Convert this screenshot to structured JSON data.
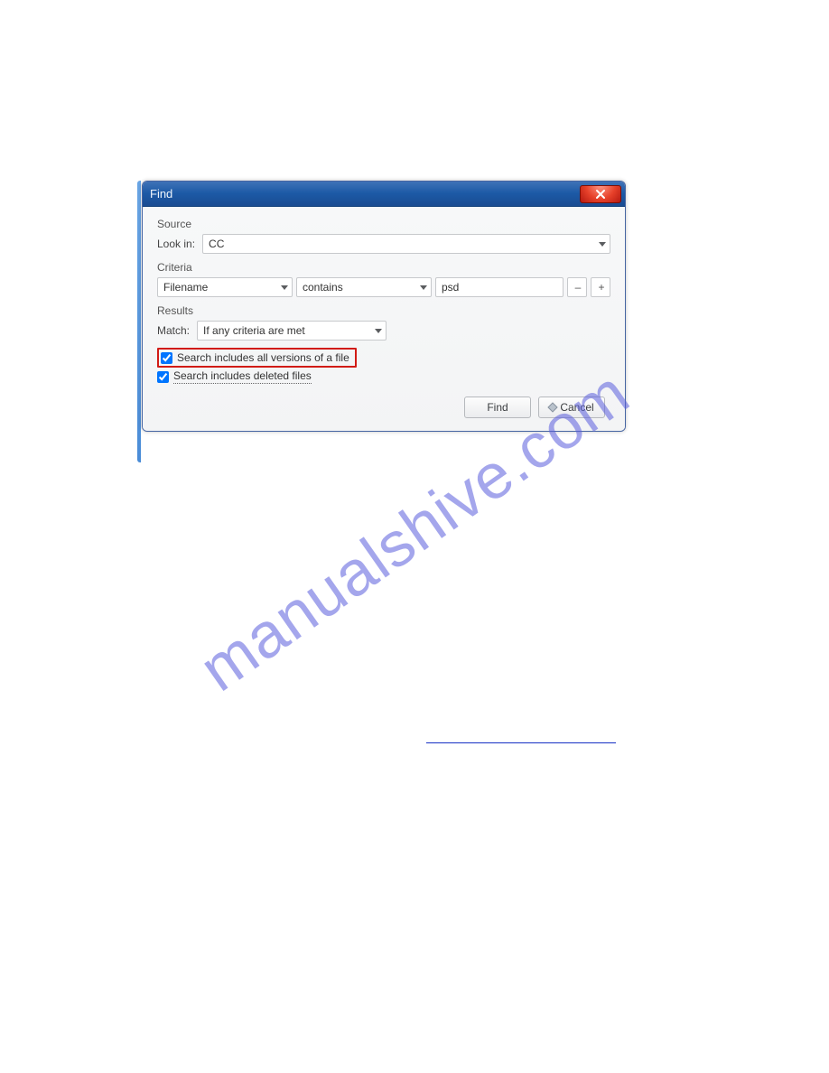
{
  "watermark": "manualshive.com",
  "dialog": {
    "title": "Find",
    "source": {
      "group_label": "Source",
      "lookin_label": "Look in:",
      "lookin_value": "CC"
    },
    "criteria": {
      "group_label": "Criteria",
      "field_value": "Filename",
      "operator_value": "contains",
      "search_value": "psd",
      "remove_label": "–",
      "add_label": "+"
    },
    "results": {
      "group_label": "Results",
      "match_label": "Match:",
      "match_value": "If any criteria are met",
      "chk_versions_label": "Search includes all versions of a file",
      "chk_versions_checked": true,
      "chk_deleted_label": "Search includes deleted files",
      "chk_deleted_checked": true
    },
    "buttons": {
      "find": "Find",
      "cancel": "Cancel"
    }
  }
}
